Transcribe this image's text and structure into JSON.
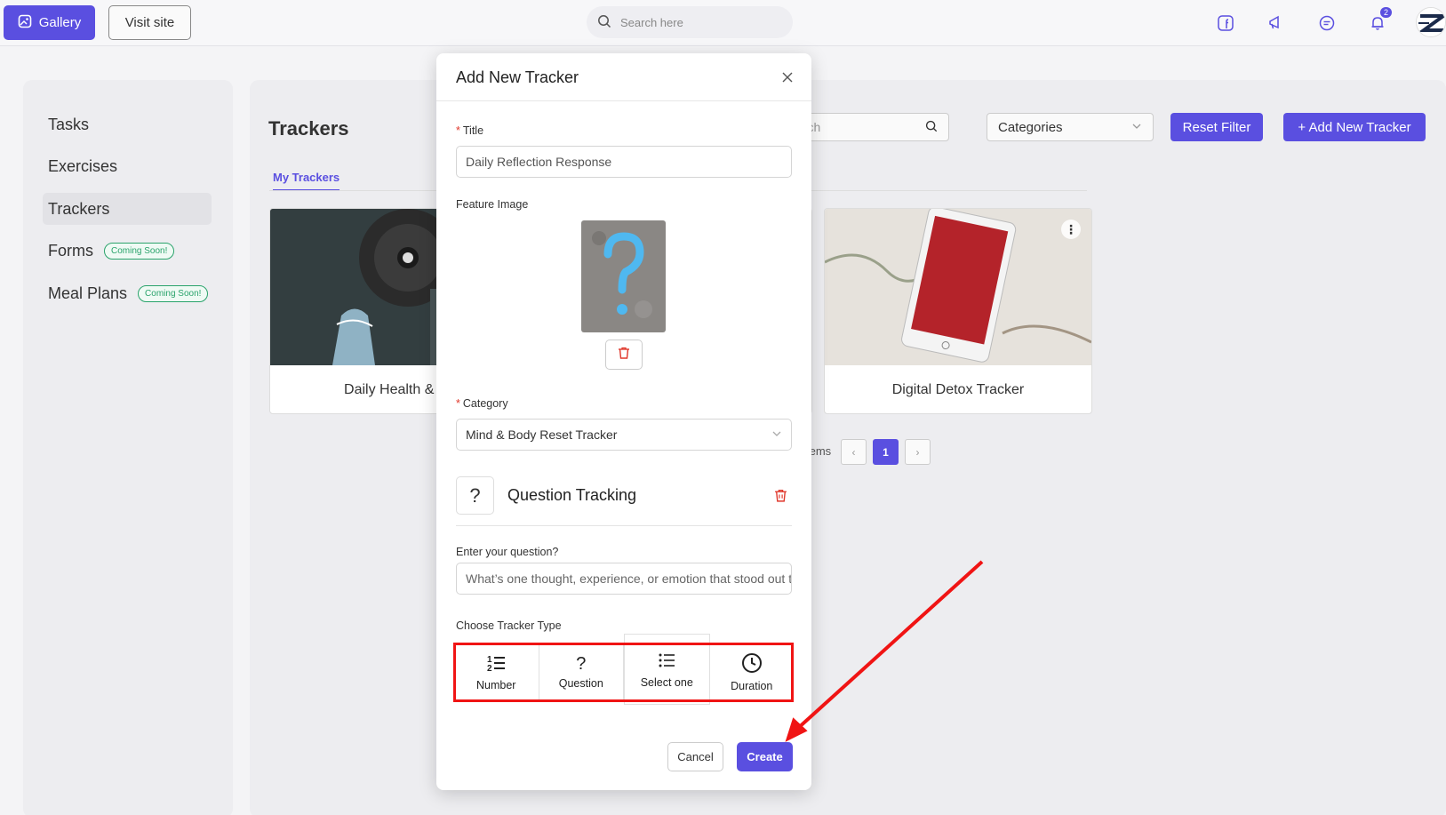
{
  "topbar": {
    "gallery_label": "Gallery",
    "visit_label": "Visit site",
    "search_placeholder": "Search here",
    "notification_count": "2"
  },
  "sidebar": {
    "items": [
      {
        "label": "Tasks"
      },
      {
        "label": "Exercises"
      },
      {
        "label": "Trackers"
      },
      {
        "label": "Forms",
        "badge": "Coming Soon!"
      },
      {
        "label": "Meal Plans",
        "badge": "Coming Soon!"
      }
    ]
  },
  "main": {
    "title": "Trackers",
    "tab": "My Trackers",
    "search_placeholder": "arch",
    "categories_label": "Categories",
    "reset_label": "Reset Filter",
    "add_label": "+ Add New Tracker",
    "cards": [
      {
        "title": "Daily Health & Progr"
      },
      {
        "title": "Digital Detox Tracker"
      }
    ],
    "pager_text": "tems",
    "current_page": "1"
  },
  "modal": {
    "title": "Add New Tracker",
    "title_label": "Title",
    "title_value": "Daily Reflection Response",
    "feature_image_label": "Feature Image",
    "category_label": "Category",
    "category_value": "Mind & Body Reset Tracker",
    "question_tracking_label": "Question Tracking",
    "question_label": "Enter your question?",
    "question_value": "What’s one thought, experience, or emotion that stood out today?",
    "tracker_type_label": "Choose Tracker Type",
    "types": [
      {
        "label": "Number",
        "icon": "numbered-list-icon"
      },
      {
        "label": "Question",
        "icon": "question-mark-icon"
      },
      {
        "label": "Select one",
        "icon": "bullet-list-icon"
      },
      {
        "label": "Duration",
        "icon": "clock-icon"
      }
    ],
    "cancel_label": "Cancel",
    "create_label": "Create"
  },
  "colors": {
    "accent": "#5a4fe0",
    "annotation_red": "#f01414",
    "success_green": "#2aa36b",
    "danger_red": "#e0382c"
  }
}
